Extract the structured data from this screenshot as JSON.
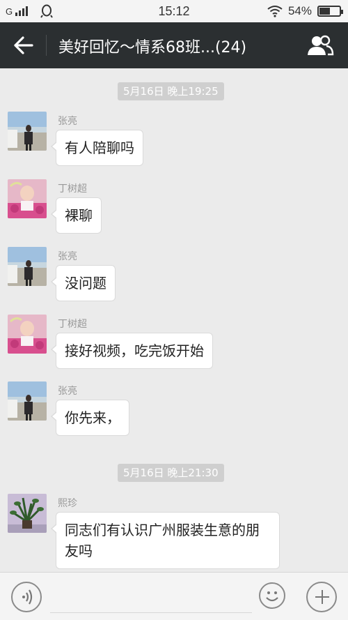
{
  "status_bar": {
    "network": "G",
    "time": "15:12",
    "battery": "54%",
    "battery_level": 0.54
  },
  "header": {
    "title": "美好回忆〜情系68班...(24)",
    "back_icon": "back-arrow-icon",
    "members_icon": "group-members-icon"
  },
  "timestamps": [
    "5月16日 晚上19:25",
    "5月16日 晚上21:30"
  ],
  "messages": [
    {
      "sender": "张亮",
      "text": "有人陪聊吗",
      "avatar": "man-by-river"
    },
    {
      "sender": "丁树超",
      "text": "裸聊",
      "avatar": "baby-in-pink"
    },
    {
      "sender": "张亮",
      "text": "没问题",
      "avatar": "man-by-river"
    },
    {
      "sender": "丁树超",
      "text": "接好视频，吃完饭开始",
      "avatar": "baby-in-pink"
    },
    {
      "sender": "张亮",
      "text": "你先来，",
      "avatar": "man-by-river"
    },
    {
      "sender": "熙珍",
      "text": "同志们有认识广州服装生意的朋友吗",
      "avatar": "potted-plant"
    }
  ],
  "input_bar": {
    "voice_icon": "voice-icon",
    "emoji_icon": "emoji-icon",
    "plus_icon": "plus-icon",
    "text_value": ""
  }
}
